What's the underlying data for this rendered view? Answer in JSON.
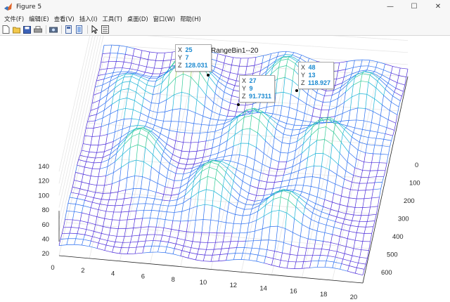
{
  "window": {
    "title": "Figure 5",
    "minimize": "—",
    "maximize": "☐",
    "close": "✕"
  },
  "menu": [
    "文件(F)",
    "编辑(E)",
    "查看(V)",
    "插入(I)",
    "工具(T)",
    "桌面(D)",
    "窗口(W)",
    "帮助(H)"
  ],
  "toolbar": {
    "buttons": [
      "new-figure-icon",
      "open-file-icon",
      "save-icon",
      "print-icon",
      "print-preview-icon",
      "link-plot-icon",
      "colorbar-icon",
      "edit-plot-arrow-icon",
      "property-inspector-icon"
    ]
  },
  "plot": {
    "title": "RangeBin1--20",
    "z_ticks": [
      "140",
      "120",
      "100",
      "80",
      "60",
      "40",
      "20"
    ],
    "x_ticks": [
      "0",
      "2",
      "4",
      "6",
      "8",
      "10",
      "12",
      "14",
      "16",
      "18",
      "20"
    ],
    "y_ticks": [
      "0",
      "100",
      "200",
      "300",
      "400",
      "500",
      "600"
    ],
    "mesh_colormap": [
      "#4b2bd9",
      "#2b6ff0",
      "#19b3d6",
      "#33cc99",
      "#99d84a",
      "#e6d726"
    ]
  },
  "datatips": [
    {
      "x_label": "X",
      "x": "25",
      "y_label": "Y",
      "y": "7",
      "z_label": "Z",
      "z": "128.031"
    },
    {
      "x_label": "X",
      "x": "27",
      "y_label": "Y",
      "y": "9",
      "z_label": "Z",
      "z": "91.7311"
    },
    {
      "x_label": "X",
      "x": "48",
      "y_label": "Y",
      "y": "13",
      "z_label": "Z",
      "z": "118.927"
    }
  ]
}
